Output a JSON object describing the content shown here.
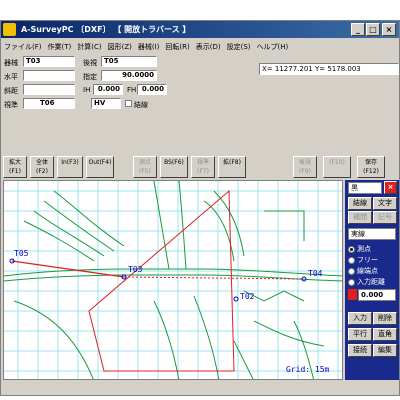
{
  "window": {
    "title": "A-SurveyPC 〔DXF〕  【 開放トラバース 】",
    "minimize": "_",
    "maximize": "□",
    "close": "×"
  },
  "menu": [
    "ファイル(F)",
    "作業(T)",
    "計算(C)",
    "図形(Z)",
    "器械(I)",
    "回転(R)",
    "表示(D)",
    "設定(S)",
    "ヘルプ(H)"
  ],
  "form": {
    "instrument_label": "器械",
    "instrument_value": "T03",
    "backsight_label": "後視",
    "backsight_value": "T05",
    "level_label": "水平",
    "level_value": "",
    "angle_label": "指定",
    "angle_value": "90.0000",
    "distance_label": "斜距",
    "distance_value": "",
    "ih_label": "IH",
    "ih_value": "0.000",
    "fh_label": "FH",
    "fh_value": "0.000",
    "point_label": "視準",
    "point_value": "T06",
    "mode_value": "HV",
    "connect_label": "結線"
  },
  "coords": "X= 11277.201  Y= 5178.003",
  "toolbar": [
    {
      "label": "拡大\n(F1)",
      "enabled": true
    },
    {
      "label": "全体\n(F2)",
      "enabled": true
    },
    {
      "label": "In(F3)",
      "enabled": true
    },
    {
      "label": "Out(F4)",
      "enabled": true
    },
    {
      "label": "測点\n(F5)",
      "enabled": false
    },
    {
      "label": "BS(F6)",
      "enabled": true
    },
    {
      "label": "視準\n(F7)",
      "enabled": false
    },
    {
      "label": "拡(F8)",
      "enabled": true
    },
    {
      "label": "後視\n(F9)",
      "enabled": false
    },
    {
      "label": "(F10)",
      "enabled": false
    },
    {
      "label": "保存\n(F12)",
      "enabled": true
    }
  ],
  "map": {
    "labels": [
      {
        "text": "T05",
        "color": "#0000cc"
      },
      {
        "text": "T03",
        "color": "#0000cc"
      },
      {
        "text": "T04",
        "color": "#0000cc"
      },
      {
        "text": "T02",
        "color": "#0000cc"
      }
    ],
    "grid_text": "Grid: 15m"
  },
  "panel": {
    "color_select": "黒",
    "close": "×",
    "tab_line": "結線",
    "tab_text": "文字",
    "tab_point": "補間",
    "tab_note": "記号",
    "line_type": "実線",
    "radios": [
      {
        "label": "測点",
        "checked": true
      },
      {
        "label": "フリー",
        "checked": false
      },
      {
        "label": "線端点",
        "checked": false
      },
      {
        "label": "入力距離",
        "checked": false
      }
    ],
    "distance_value": "0.000",
    "btn_input": "入力",
    "btn_delete": "削除",
    "btn_parallel": "平行",
    "btn_right_angle": "直角",
    "btn_connect": "接続",
    "btn_edit": "編集"
  }
}
